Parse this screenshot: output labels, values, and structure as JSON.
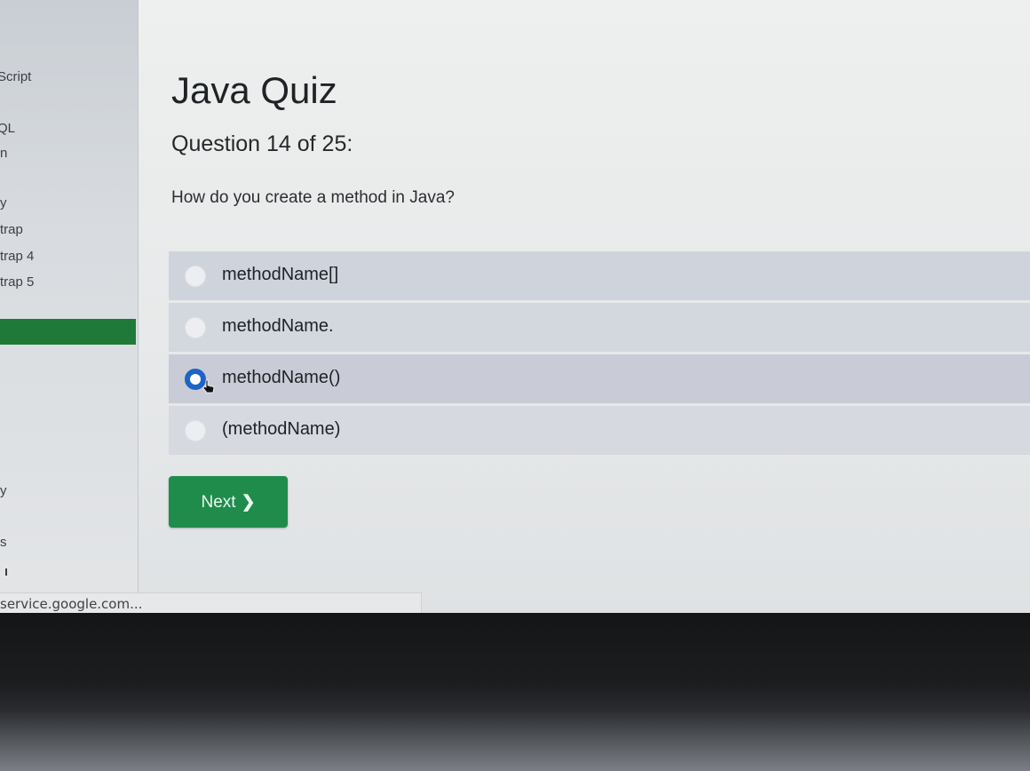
{
  "sidebar": {
    "items": [
      {
        "label": "Script"
      },
      {
        "label": "QL"
      },
      {
        "label": "n"
      },
      {
        "label": "y"
      },
      {
        "label": "trap"
      },
      {
        "label": "trap 4"
      },
      {
        "label": "trap 5"
      },
      {
        "label": "y"
      },
      {
        "label": "s"
      }
    ],
    "active_color": "#1f7a3a"
  },
  "quiz": {
    "title": "Java Quiz",
    "question_number": "Question 14 of 25:",
    "question_text": "How do you create a method in Java?",
    "options": [
      {
        "label": "methodName[]",
        "selected": false
      },
      {
        "label": "methodName.",
        "selected": false
      },
      {
        "label": "methodName()",
        "selected": true
      },
      {
        "label": "(methodName)",
        "selected": false
      }
    ],
    "next_label": "Next",
    "next_color": "#1f8c4c",
    "radio_selected_color": "#1e63c6"
  },
  "status": {
    "url_text": "service.google.com..."
  }
}
